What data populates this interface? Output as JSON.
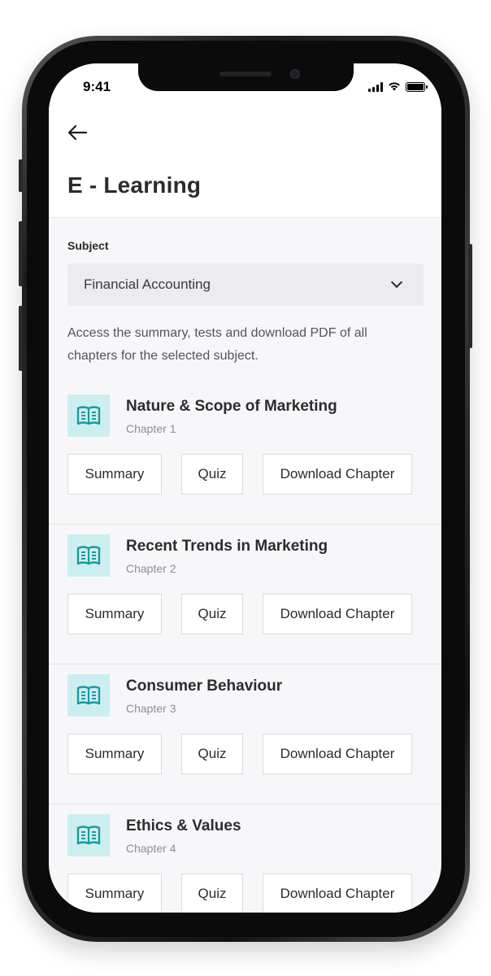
{
  "status_bar": {
    "time": "9:41"
  },
  "header": {
    "back_icon": "arrow-left-icon",
    "title": "E - Learning"
  },
  "subject": {
    "label": "Subject",
    "selected": "Financial Accounting",
    "description": "Access the summary, tests  and download PDF of all chapters for the selected subject."
  },
  "chapters": [
    {
      "title": "Nature & Scope of Marketing",
      "subtitle": "Chapter 1"
    },
    {
      "title": "Recent Trends in Marketing",
      "subtitle": "Chapter 2"
    },
    {
      "title": "Consumer Behaviour",
      "subtitle": "Chapter 3"
    },
    {
      "title": "Ethics & Values",
      "subtitle": "Chapter 4"
    }
  ],
  "actions": {
    "summary": "Summary",
    "quiz": "Quiz",
    "download": "Download Chapter"
  },
  "colors": {
    "accent": "#1a9aa0",
    "icon_bg": "#cdeef0",
    "select_bg": "#ececef"
  }
}
